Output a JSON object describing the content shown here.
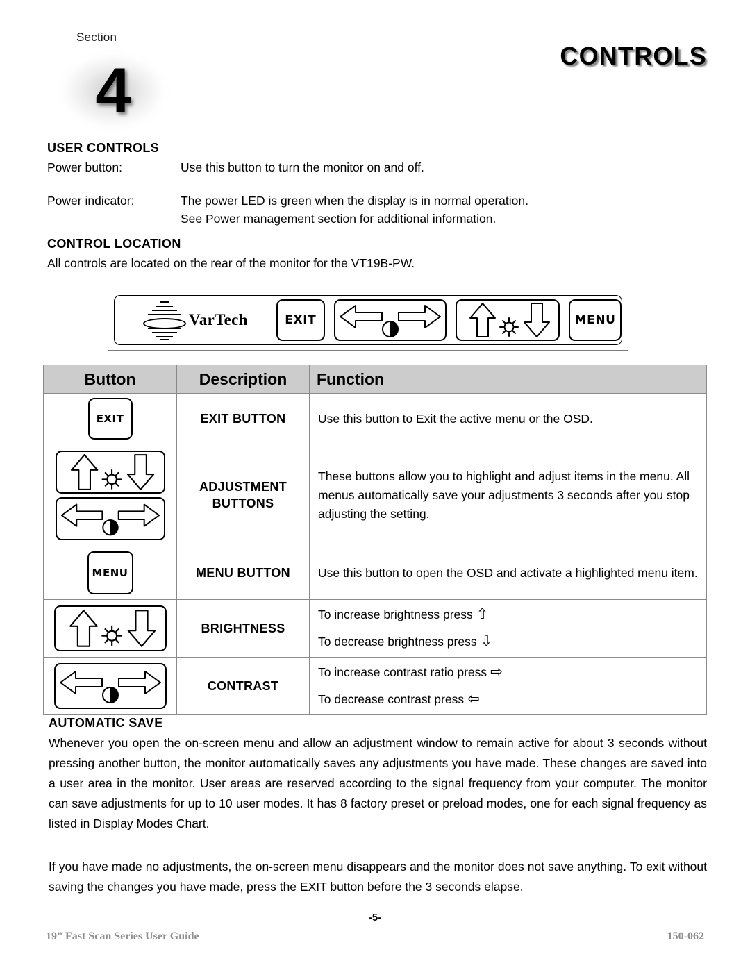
{
  "header": {
    "section_word": "Section",
    "section_number": "4",
    "title": "CONTROLS"
  },
  "user_controls": {
    "heading": "USER CONTROLS",
    "rows": [
      {
        "label": "Power button:",
        "lines": [
          "Use this button to turn the monitor on and off."
        ]
      },
      {
        "label": "Power indicator:",
        "lines": [
          "The power LED is green when the display is in normal operation.",
          "See Power management section for additional information."
        ]
      }
    ]
  },
  "control_location": {
    "heading": "CONTROL LOCATION",
    "text": "All controls are located on the rear of the monitor for the VT19B-PW."
  },
  "control_panel": {
    "brand": "VarTech",
    "brand_mark": "vartech-logo-icon",
    "buttons": [
      {
        "name": "exit-button",
        "label": "EXIT"
      },
      {
        "name": "contrast-buttons",
        "label": "",
        "icons": [
          "left-arrow-icon",
          "contrast-icon",
          "right-arrow-icon"
        ]
      },
      {
        "name": "brightness-buttons",
        "label": "",
        "icons": [
          "up-arrow-icon",
          "brightness-sun-icon",
          "down-arrow-icon"
        ]
      },
      {
        "name": "menu-button",
        "label": "MENU"
      }
    ]
  },
  "table": {
    "columns": [
      "Button",
      "Description",
      "Function"
    ],
    "rows": [
      {
        "button_icons": [
          "exit-key-icon"
        ],
        "button_text": "EXIT",
        "description": "EXIT BUTTON",
        "function_lines": [
          "Use this button to Exit the active menu or the OSD."
        ]
      },
      {
        "button_icons": [
          "brightness-key-icon",
          "contrast-key-icon"
        ],
        "button_text": "",
        "description": "ADJUSTMENT BUTTONS",
        "description_line1": "ADJUSTMENT",
        "description_line2": "BUTTONS",
        "function_lines": [
          "These buttons allow you to highlight and adjust items in the menu. All menus automatically save your adjustments 3 seconds after you stop adjusting the setting."
        ]
      },
      {
        "button_icons": [
          "menu-key-icon"
        ],
        "button_text": "MENU",
        "description": "MENU BUTTON",
        "function_lines": [
          "Use this button to open the OSD and activate a highlighted menu item."
        ]
      },
      {
        "button_icons": [
          "brightness-key-icon"
        ],
        "button_text": "",
        "description": "BRIGHTNESS",
        "function_lines": [
          "To increase brightness press ",
          "To decrease brightness press "
        ],
        "function_glyphs": [
          "⇧",
          "⇩"
        ]
      },
      {
        "button_icons": [
          "contrast-key-icon"
        ],
        "button_text": "",
        "description": "CONTRAST",
        "function_lines": [
          "To increase contrast ratio press ",
          "To decrease contrast press "
        ],
        "function_glyphs": [
          "⇨",
          "⇦"
        ]
      }
    ]
  },
  "automatic_save": {
    "heading": "AUTOMATIC SAVE",
    "paragraph1": "Whenever you open the on-screen menu and allow an adjustment window to remain active for about 3 seconds without pressing another button, the monitor automatically saves any adjustments you have made. These changes are saved into a user area in the monitor. User areas are reserved according to the signal frequency from your computer. The monitor can save adjustments for up to 10 user modes. It has 8 factory preset or preload modes, one for each signal frequency as listed in Display Modes Chart.",
    "paragraph2": "If you have made no adjustments, the on-screen menu disappears and the monitor does not save anything. To exit without saving the changes you have made, press the EXIT button before the 3 seconds elapse."
  },
  "footer": {
    "page_number": "-5-",
    "left": "19” Fast Scan Series User Guide",
    "right": "150-062"
  },
  "colors": {
    "table_header_bg": "#cccccc",
    "table_border": "#8a8a8a",
    "footer_text": "#8d8d8d",
    "ink": "#000000"
  }
}
